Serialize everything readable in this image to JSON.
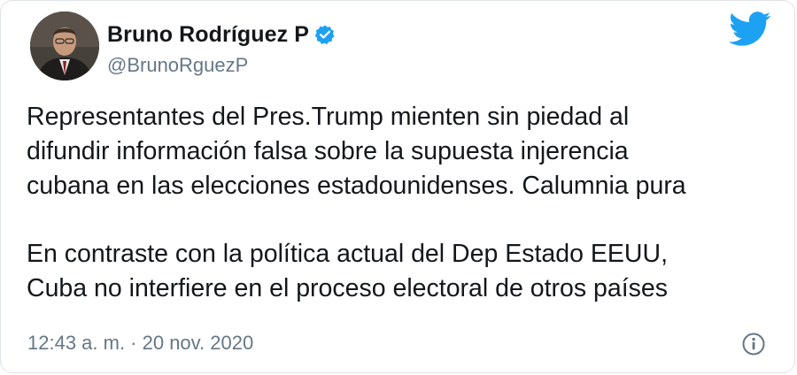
{
  "author": {
    "name": "Bruno Rodríguez P",
    "handle": "@BrunoRguezP",
    "verified": true
  },
  "tweet": {
    "paragraphs": [
      [
        "Representantes del Pres.Trump mienten sin piedad al",
        "difundir información falsa sobre la supuesta injerencia",
        "cubana en las elecciones estadounidenses. Calumnia pura"
      ],
      [
        "En contraste con la política actual del Dep Estado EEUU,",
        "Cuba no interfiere en el proceso electoral de otros países"
      ]
    ],
    "timestamp": "12:43 a. m. · 20 nov. 2020"
  },
  "icons": {
    "brand": "twitter-bird-icon",
    "verified": "verified-badge-icon",
    "info": "info-icon"
  },
  "colors": {
    "brand": "#1da1f2",
    "text": "#14171a",
    "secondary": "#657786"
  }
}
